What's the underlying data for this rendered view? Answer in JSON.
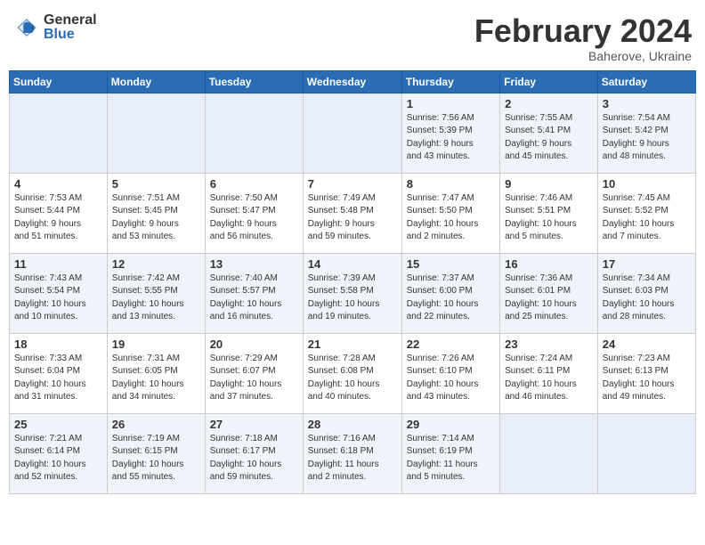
{
  "logo": {
    "general": "General",
    "blue": "Blue"
  },
  "header": {
    "month": "February 2024",
    "location": "Baherove, Ukraine"
  },
  "weekdays": [
    "Sunday",
    "Monday",
    "Tuesday",
    "Wednesday",
    "Thursday",
    "Friday",
    "Saturday"
  ],
  "weeks": [
    [
      {
        "day": "",
        "info": ""
      },
      {
        "day": "",
        "info": ""
      },
      {
        "day": "",
        "info": ""
      },
      {
        "day": "",
        "info": ""
      },
      {
        "day": "1",
        "info": "Sunrise: 7:56 AM\nSunset: 5:39 PM\nDaylight: 9 hours\nand 43 minutes."
      },
      {
        "day": "2",
        "info": "Sunrise: 7:55 AM\nSunset: 5:41 PM\nDaylight: 9 hours\nand 45 minutes."
      },
      {
        "day": "3",
        "info": "Sunrise: 7:54 AM\nSunset: 5:42 PM\nDaylight: 9 hours\nand 48 minutes."
      }
    ],
    [
      {
        "day": "4",
        "info": "Sunrise: 7:53 AM\nSunset: 5:44 PM\nDaylight: 9 hours\nand 51 minutes."
      },
      {
        "day": "5",
        "info": "Sunrise: 7:51 AM\nSunset: 5:45 PM\nDaylight: 9 hours\nand 53 minutes."
      },
      {
        "day": "6",
        "info": "Sunrise: 7:50 AM\nSunset: 5:47 PM\nDaylight: 9 hours\nand 56 minutes."
      },
      {
        "day": "7",
        "info": "Sunrise: 7:49 AM\nSunset: 5:48 PM\nDaylight: 9 hours\nand 59 minutes."
      },
      {
        "day": "8",
        "info": "Sunrise: 7:47 AM\nSunset: 5:50 PM\nDaylight: 10 hours\nand 2 minutes."
      },
      {
        "day": "9",
        "info": "Sunrise: 7:46 AM\nSunset: 5:51 PM\nDaylight: 10 hours\nand 5 minutes."
      },
      {
        "day": "10",
        "info": "Sunrise: 7:45 AM\nSunset: 5:52 PM\nDaylight: 10 hours\nand 7 minutes."
      }
    ],
    [
      {
        "day": "11",
        "info": "Sunrise: 7:43 AM\nSunset: 5:54 PM\nDaylight: 10 hours\nand 10 minutes."
      },
      {
        "day": "12",
        "info": "Sunrise: 7:42 AM\nSunset: 5:55 PM\nDaylight: 10 hours\nand 13 minutes."
      },
      {
        "day": "13",
        "info": "Sunrise: 7:40 AM\nSunset: 5:57 PM\nDaylight: 10 hours\nand 16 minutes."
      },
      {
        "day": "14",
        "info": "Sunrise: 7:39 AM\nSunset: 5:58 PM\nDaylight: 10 hours\nand 19 minutes."
      },
      {
        "day": "15",
        "info": "Sunrise: 7:37 AM\nSunset: 6:00 PM\nDaylight: 10 hours\nand 22 minutes."
      },
      {
        "day": "16",
        "info": "Sunrise: 7:36 AM\nSunset: 6:01 PM\nDaylight: 10 hours\nand 25 minutes."
      },
      {
        "day": "17",
        "info": "Sunrise: 7:34 AM\nSunset: 6:03 PM\nDaylight: 10 hours\nand 28 minutes."
      }
    ],
    [
      {
        "day": "18",
        "info": "Sunrise: 7:33 AM\nSunset: 6:04 PM\nDaylight: 10 hours\nand 31 minutes."
      },
      {
        "day": "19",
        "info": "Sunrise: 7:31 AM\nSunset: 6:05 PM\nDaylight: 10 hours\nand 34 minutes."
      },
      {
        "day": "20",
        "info": "Sunrise: 7:29 AM\nSunset: 6:07 PM\nDaylight: 10 hours\nand 37 minutes."
      },
      {
        "day": "21",
        "info": "Sunrise: 7:28 AM\nSunset: 6:08 PM\nDaylight: 10 hours\nand 40 minutes."
      },
      {
        "day": "22",
        "info": "Sunrise: 7:26 AM\nSunset: 6:10 PM\nDaylight: 10 hours\nand 43 minutes."
      },
      {
        "day": "23",
        "info": "Sunrise: 7:24 AM\nSunset: 6:11 PM\nDaylight: 10 hours\nand 46 minutes."
      },
      {
        "day": "24",
        "info": "Sunrise: 7:23 AM\nSunset: 6:13 PM\nDaylight: 10 hours\nand 49 minutes."
      }
    ],
    [
      {
        "day": "25",
        "info": "Sunrise: 7:21 AM\nSunset: 6:14 PM\nDaylight: 10 hours\nand 52 minutes."
      },
      {
        "day": "26",
        "info": "Sunrise: 7:19 AM\nSunset: 6:15 PM\nDaylight: 10 hours\nand 55 minutes."
      },
      {
        "day": "27",
        "info": "Sunrise: 7:18 AM\nSunset: 6:17 PM\nDaylight: 10 hours\nand 59 minutes."
      },
      {
        "day": "28",
        "info": "Sunrise: 7:16 AM\nSunset: 6:18 PM\nDaylight: 11 hours\nand 2 minutes."
      },
      {
        "day": "29",
        "info": "Sunrise: 7:14 AM\nSunset: 6:19 PM\nDaylight: 11 hours\nand 5 minutes."
      },
      {
        "day": "",
        "info": ""
      },
      {
        "day": "",
        "info": ""
      }
    ]
  ]
}
